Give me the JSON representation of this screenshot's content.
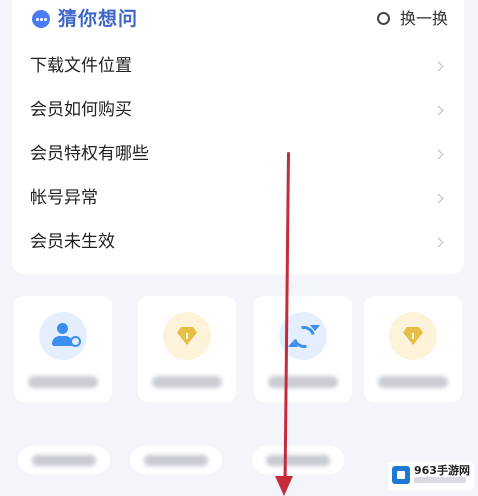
{
  "faq": {
    "title": "猜你想问",
    "refresh_label": "换一换",
    "questions": [
      {
        "label": "下载文件位置"
      },
      {
        "label": "会员如何购买"
      },
      {
        "label": "会员特权有哪些"
      },
      {
        "label": "帐号异常"
      },
      {
        "label": "会员未生效"
      }
    ]
  },
  "watermark": {
    "name": "963手游网"
  },
  "colors": {
    "accent": "#4b7bf5",
    "title": "#3f67c8",
    "annotation_arrow": "#c52b3b"
  }
}
